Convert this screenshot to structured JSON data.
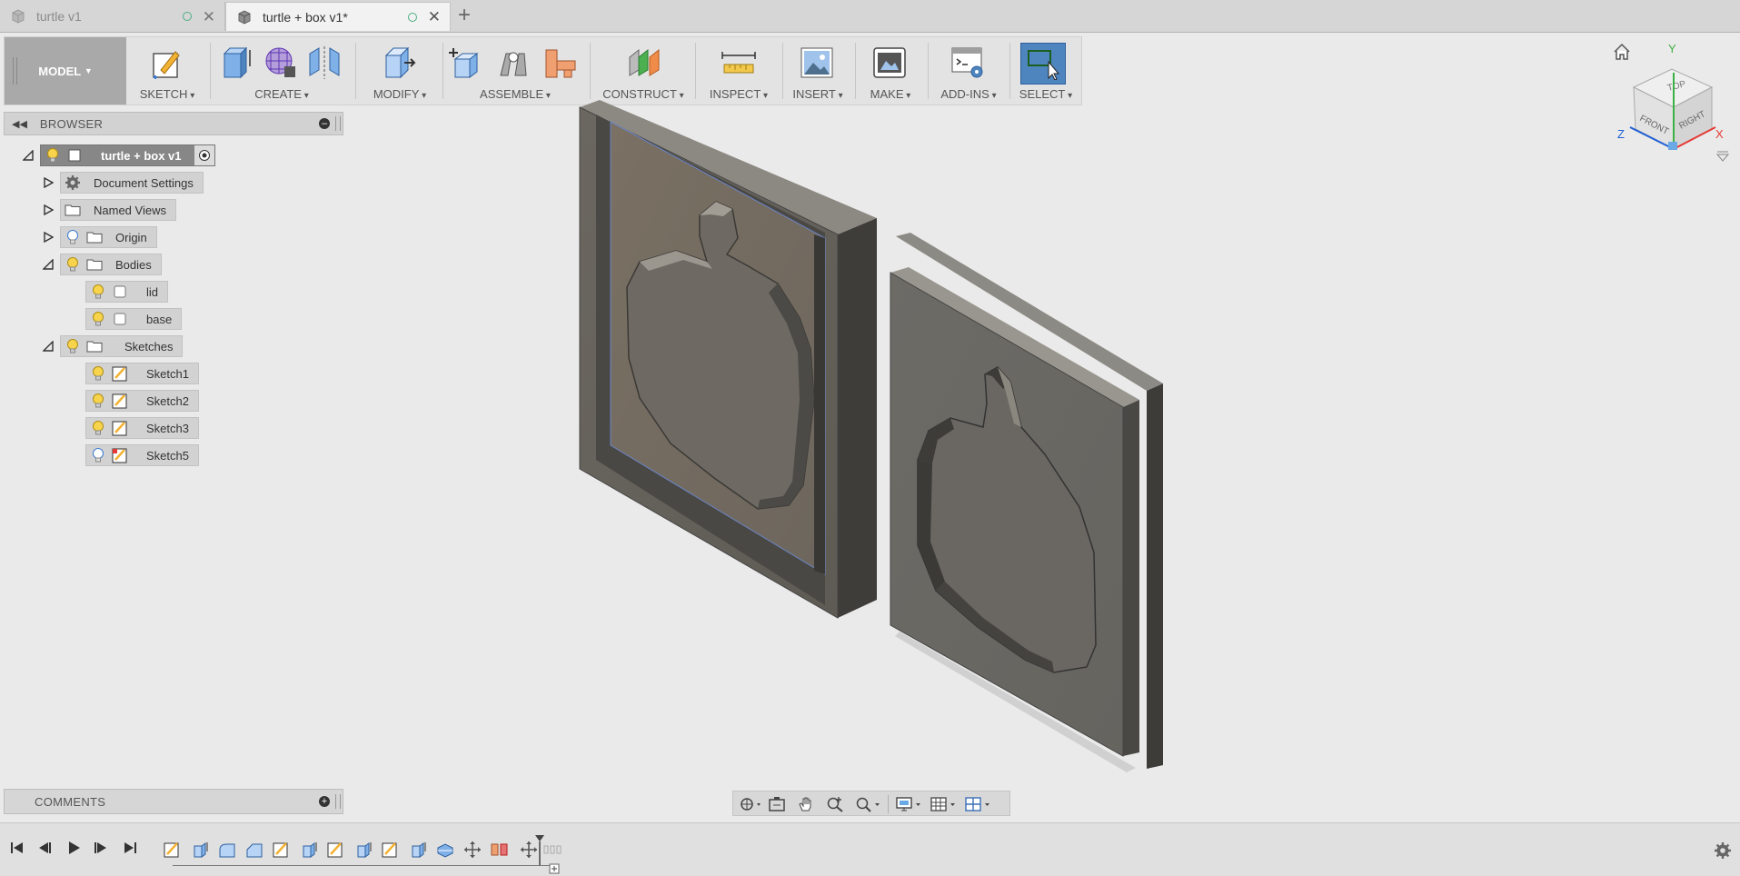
{
  "tabs": [
    {
      "label": "turtle v1",
      "active": false
    },
    {
      "label": "turtle + box v1*",
      "active": true
    }
  ],
  "toolbar": {
    "workspace": "MODEL",
    "groups": [
      {
        "label": "SKETCH"
      },
      {
        "label": "CREATE"
      },
      {
        "label": "MODIFY"
      },
      {
        "label": "ASSEMBLE"
      },
      {
        "label": "CONSTRUCT"
      },
      {
        "label": "INSPECT"
      },
      {
        "label": "INSERT"
      },
      {
        "label": "MAKE"
      },
      {
        "label": "ADD-INS"
      },
      {
        "label": "SELECT"
      }
    ]
  },
  "browser": {
    "title": "BROWSER",
    "root": "turtle + box v1",
    "items": [
      {
        "label": "Document Settings"
      },
      {
        "label": "Named Views"
      },
      {
        "label": "Origin"
      },
      {
        "label": "Bodies"
      },
      {
        "label": "lid"
      },
      {
        "label": "base"
      },
      {
        "label": "Sketches"
      },
      {
        "label": "Sketch1"
      },
      {
        "label": "Sketch2"
      },
      {
        "label": "Sketch3"
      },
      {
        "label": "Sketch5"
      }
    ]
  },
  "comments": {
    "title": "COMMENTS"
  },
  "viewcube": {
    "top": "TOP",
    "front": "FRONT",
    "right": "RIGHT",
    "axis_x": "X",
    "axis_y": "Y",
    "axis_z": "Z"
  },
  "colors": {
    "accent_select": "#4f85bf",
    "axis_x": "#e53935",
    "axis_y": "#3cb043",
    "axis_z": "#1e5fd6",
    "body": "#6f6c64"
  }
}
